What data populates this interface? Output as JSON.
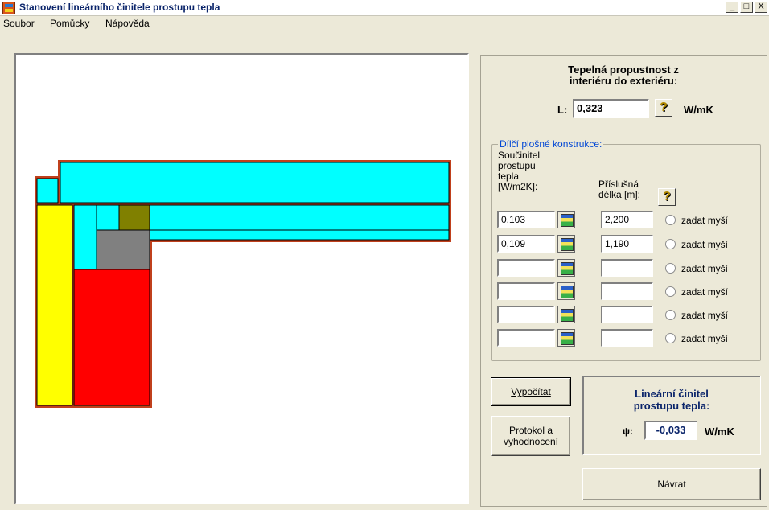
{
  "window": {
    "title": "Stanovení lineárního činitele prostupu tepla",
    "controls": {
      "minimize": "_",
      "maximize": "□",
      "close": "X"
    }
  },
  "menu": [
    "Soubor",
    "Pomůcky",
    "Nápověda"
  ],
  "thermal": {
    "title_line1": "Tepelná propustnost z",
    "title_line2": "interiéru do exteriéru:",
    "l_label": "L:",
    "l_value": "0,323",
    "unit": "W/mK",
    "help_icon": "?"
  },
  "group": {
    "legend": "Dílčí plošné konstrukce:",
    "col1_header": [
      "Součinitel",
      "prostupu",
      "tepla",
      "[W/m2K]:"
    ],
    "col2_header": [
      "Příslušná",
      "délka [m]:"
    ],
    "help_icon": "?",
    "radio_label": "zadat myší",
    "rows": [
      {
        "u": "0,103",
        "length": "2,200"
      },
      {
        "u": "0,109",
        "length": "1,190"
      },
      {
        "u": "",
        "length": ""
      },
      {
        "u": "",
        "length": ""
      },
      {
        "u": "",
        "length": ""
      },
      {
        "u": "",
        "length": ""
      }
    ]
  },
  "buttons": {
    "compute": "Vypočítat",
    "protocol_line1": "Protokol a",
    "protocol_line2": "vyhodnocení",
    "back": "Návrat"
  },
  "result": {
    "title_line1": "Lineární činitel",
    "title_line2": "prostupu tepla:",
    "psi_symbol": "ψ:",
    "psi_value": "-0,033",
    "unit": "W/mK"
  },
  "colors": {
    "outline": "#c0401c",
    "insulation_cyan": "#00ffff",
    "concrete_red": "#ff0000",
    "yellow_layer": "#ffff00",
    "grey_block": "#808080",
    "olive_block": "#808000",
    "title_blue": "#0a246a"
  }
}
